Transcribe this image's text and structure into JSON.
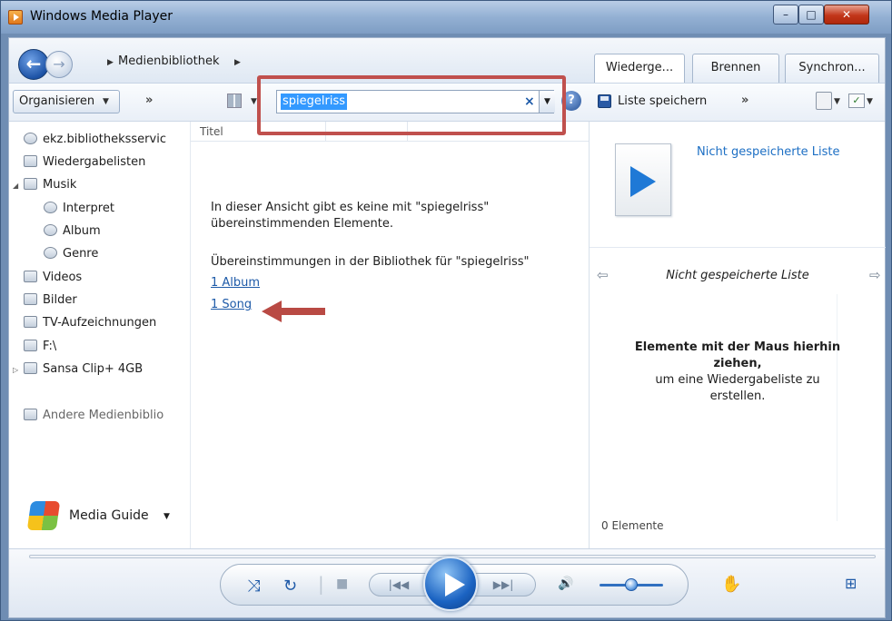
{
  "window": {
    "title": "Windows Media Player",
    "controls": {
      "minimize": "–",
      "maximize": "□",
      "close": "✕"
    }
  },
  "nav": {
    "breadcrumb": "Medienbibliothek",
    "tabs": [
      {
        "label": "Wiederge...",
        "active": true
      },
      {
        "label": "Brennen",
        "active": false
      },
      {
        "label": "Synchron...",
        "active": false
      }
    ]
  },
  "toolbar": {
    "organize_label": "Organisieren",
    "more": "»",
    "search_value": "spiegelriss",
    "search_clear": "×",
    "help": "?"
  },
  "right_toolbar": {
    "save_list": "Liste speichern",
    "more": "»"
  },
  "sidebar": {
    "items": [
      {
        "label": "ekz.bibliotheksservic",
        "icon": "user-icon"
      },
      {
        "label": "Wiedergabelisten",
        "icon": "playlist-icon"
      },
      {
        "label": "Musik",
        "icon": "music-icon"
      },
      {
        "label": "Interpret",
        "icon": "artist-icon"
      },
      {
        "label": "Album",
        "icon": "album-icon"
      },
      {
        "label": "Genre",
        "icon": "genre-icon"
      },
      {
        "label": "Videos",
        "icon": "video-icon"
      },
      {
        "label": "Bilder",
        "icon": "picture-icon"
      },
      {
        "label": "TV-Aufzeichnungen",
        "icon": "tv-icon"
      },
      {
        "label": "F:\\",
        "icon": "drive-icon"
      },
      {
        "label": "Sansa Clip+ 4GB",
        "icon": "device-icon"
      },
      {
        "label": "Andere Medienbiblio",
        "icon": "network-icon"
      }
    ],
    "guide": "Media Guide"
  },
  "main": {
    "column_title": "Titel",
    "no_results_line1": "In dieser Ansicht gibt es keine mit \"spiegelriss\"",
    "no_results_line2": "übereinstimmenden Elemente.",
    "matches_heading": "Übereinstimmungen in der Bibliothek für \"spiegelriss\"",
    "links": [
      "1 Album",
      "1 Song"
    ]
  },
  "right_pane": {
    "unsaved_title": "Nicht gespeicherte Liste",
    "list_label": "Nicht gespeicherte Liste",
    "drop_bold_line1": "Elemente mit der Maus hierhin",
    "drop_bold_line2": "ziehen,",
    "drop_line3": "um eine Wiedergabeliste zu",
    "drop_line4": "erstellen.",
    "count": "0 Elemente"
  },
  "annotations": {
    "highlight_color": "#c0504d"
  },
  "player": {
    "shuffle": "⤨",
    "repeat": "↻",
    "stop": "■",
    "prev": "|◀◀",
    "next": "▶▶|",
    "mute": "🔊",
    "volume_level": 0.5
  }
}
